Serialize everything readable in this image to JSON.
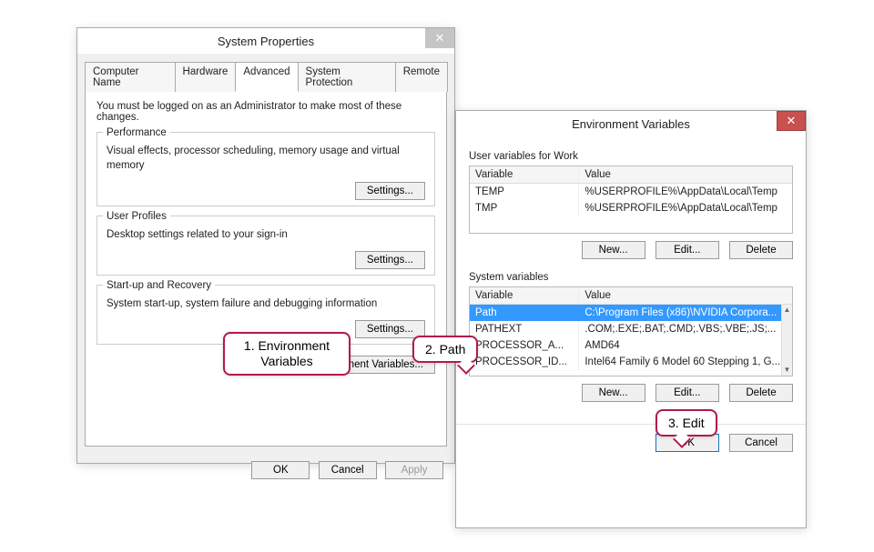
{
  "sysprops": {
    "title": "System Properties",
    "tabs": [
      "Computer Name",
      "Hardware",
      "Advanced",
      "System Protection",
      "Remote"
    ],
    "active_tab_index": 2,
    "notice": "You must be logged on as an Administrator to make most of these changes.",
    "performance": {
      "title": "Performance",
      "desc": "Visual effects, processor scheduling, memory usage and virtual memory",
      "settings_btn": "Settings..."
    },
    "user_profiles": {
      "title": "User Profiles",
      "desc": "Desktop settings related to your sign-in",
      "settings_btn": "Settings..."
    },
    "startup": {
      "title": "Start-up and Recovery",
      "desc": "System start-up, system failure and debugging information",
      "settings_btn": "Settings..."
    },
    "env_btn": "Environment Variables...",
    "buttons": {
      "ok": "OK",
      "cancel": "Cancel",
      "apply": "Apply"
    }
  },
  "envvars": {
    "title": "Environment Variables",
    "user_section": "User variables for Work",
    "col_variable": "Variable",
    "col_value": "Value",
    "user_rows": [
      {
        "var": "TEMP",
        "val": "%USERPROFILE%\\AppData\\Local\\Temp"
      },
      {
        "var": "TMP",
        "val": "%USERPROFILE%\\AppData\\Local\\Temp"
      }
    ],
    "sys_section": "System variables",
    "sys_rows": [
      {
        "var": "Path",
        "val": "C:\\Program Files (x86)\\NVIDIA Corpora...",
        "selected": true
      },
      {
        "var": "PATHEXT",
        "val": ".COM;.EXE;.BAT;.CMD;.VBS;.VBE;.JS;..."
      },
      {
        "var": "PROCESSOR_A...",
        "val": "AMD64"
      },
      {
        "var": "PROCESSOR_ID...",
        "val": "Intel64 Family 6 Model 60 Stepping 1, G..."
      }
    ],
    "buttons": {
      "new": "New...",
      "edit": "Edit...",
      "delete": "Delete",
      "ok": "OK",
      "cancel": "Cancel"
    }
  },
  "callouts": {
    "c1": "1. Environment Variables",
    "c2": "2. Path",
    "c3": "3. Edit"
  }
}
